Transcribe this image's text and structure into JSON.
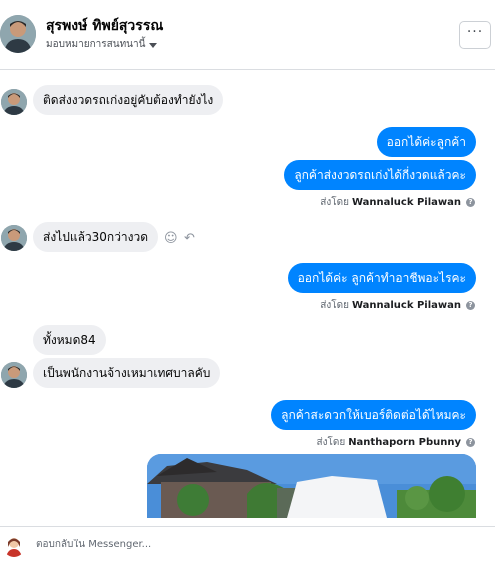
{
  "header": {
    "contact_name": "สุรพงษ์ ทิพย์สุวรรณ",
    "assign_label": "มอบหมายการสนทนานี้",
    "more_label": "···"
  },
  "messages": {
    "m1": "ติดส่งงวดรถเก่งอยู่คับต้องทำยังไง",
    "m2": "ออกได้ค่ะลูกค้า",
    "m3": "ลูกค้าส่งงวดรถเก่งได้กี่งวดแล้วคะ",
    "m4": "ส่งไปแล้ว30กว่างวด",
    "m5": "ออกได้ค่ะ ลูกค้าทำอาชีพอะไรคะ",
    "m6": "ทั้งหมด84",
    "m7": "เป็นพนักงานจ้างเหมาเทศบาลคับ",
    "m8": "ลูกค้าสะดวกให้เบอร์ติดต่อได้ไหมคะ"
  },
  "sent_by": {
    "prefix": "ส่งโดย",
    "agent1": "Wannaluck Pilawan",
    "agent2": "Nanthaporn Pbunny",
    "help_glyph": "?"
  },
  "reactions": {
    "emoji_glyph": "☺",
    "reply_glyph": "↶"
  },
  "composer": {
    "placeholder": "ตอบกลับใน Messenger..."
  },
  "colors": {
    "outgoing_bubble": "#0084ff",
    "incoming_bubble": "#eeeff2"
  }
}
